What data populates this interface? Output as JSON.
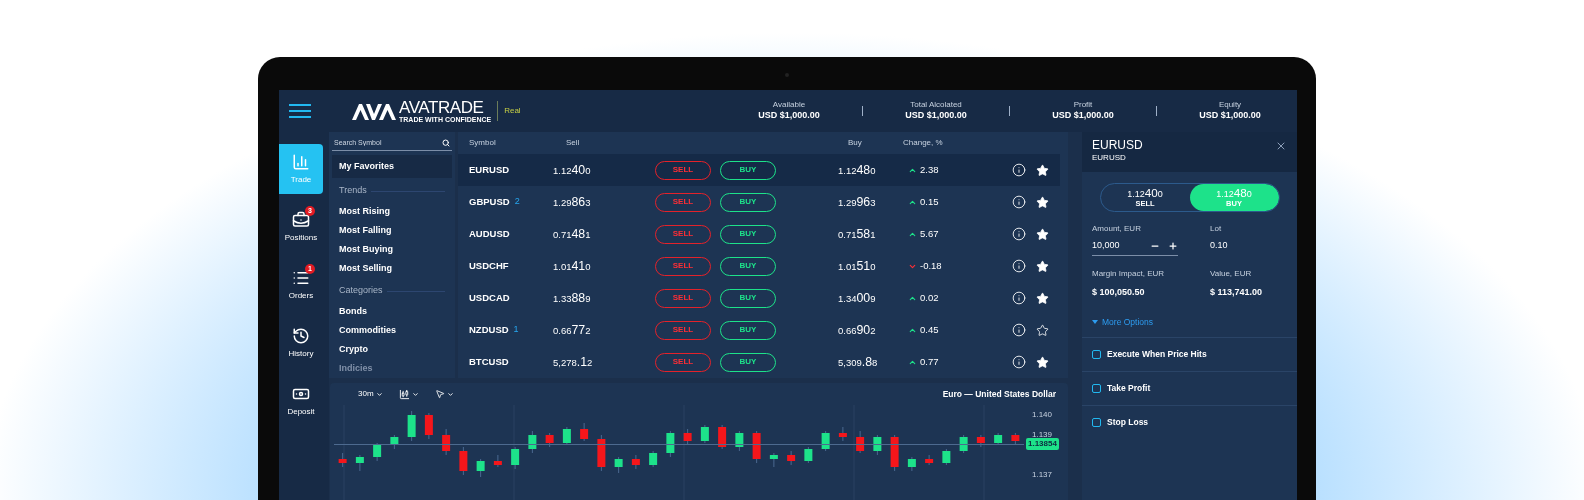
{
  "header": {
    "brand": "AVATRADE",
    "tagline": "TRADE WITH CONFIDENCE",
    "account": "Real",
    "stats": [
      {
        "label": "Available",
        "value": "USD $1,000.00"
      },
      {
        "label": "Total Alcolated",
        "value": "USD $1,000.00"
      },
      {
        "label": "Profit",
        "value": "USD $1,000.00"
      },
      {
        "label": "Equity",
        "value": "USD $1,000.00"
      }
    ]
  },
  "nav": [
    {
      "label": "Trade",
      "selected": true
    },
    {
      "label": "Positions",
      "badge": "3",
      "selected": false
    },
    {
      "label": "Orders",
      "badge": "1",
      "selected": false
    },
    {
      "label": "History",
      "selected": false
    },
    {
      "label": "Deposit",
      "selected": false
    }
  ],
  "sidebar": {
    "search": {
      "placeholder": "Search Symbol"
    },
    "items": [
      {
        "kind": "item",
        "label": "My Favorites",
        "selected": true
      },
      {
        "kind": "heading",
        "label": "Trends"
      },
      {
        "kind": "item",
        "label": "Most Rising",
        "selected": false
      },
      {
        "kind": "item",
        "label": "Most Falling",
        "selected": false
      },
      {
        "kind": "item",
        "label": "Most Buying",
        "selected": false
      },
      {
        "kind": "item",
        "label": "Most Selling",
        "selected": false
      },
      {
        "kind": "heading",
        "label": "Categories"
      },
      {
        "kind": "item",
        "label": "Bonds",
        "selected": false
      },
      {
        "kind": "item",
        "label": "Commodities",
        "selected": false
      },
      {
        "kind": "item",
        "label": "Crypto",
        "selected": false
      },
      {
        "kind": "item",
        "label": "Indicies",
        "selected": false
      }
    ]
  },
  "table": {
    "columns": [
      "Symbol",
      "Sell",
      "Buy",
      "Change, %"
    ],
    "rows": [
      {
        "symbol": "EURUSD",
        "sell": "1.12400",
        "sell_label": "SELL",
        "buy_label": "BUY",
        "buy": "1.12480",
        "change": "2.38",
        "kind": "up",
        "favorite": true,
        "selected": true
      },
      {
        "symbol": "GBPUSD",
        "count": "2",
        "sell": "1.29863",
        "sell_label": "SELL",
        "buy_label": "BUY",
        "buy": "1.29963",
        "change": "0.15",
        "kind": "up",
        "favorite": true,
        "selected": false
      },
      {
        "symbol": "AUDUSD",
        "sell": "0.71481",
        "sell_label": "SELL",
        "buy_label": "BUY",
        "buy": "0.71581",
        "change": "5.67",
        "kind": "up",
        "favorite": true,
        "selected": false
      },
      {
        "symbol": "USDCHF",
        "sell": "1.01410",
        "sell_label": "SELL",
        "buy_label": "BUY",
        "buy": "1.01510",
        "change": "-0.18",
        "kind": "down",
        "favorite": true,
        "selected": false
      },
      {
        "symbol": "USDCAD",
        "sell": "1.33889",
        "sell_label": "SELL",
        "buy_label": "BUY",
        "buy": "1.34009",
        "change": "0.02",
        "kind": "up",
        "favorite": true,
        "selected": false
      },
      {
        "symbol": "NZDUSD",
        "count": "1",
        "sell": "0.66772",
        "sell_label": "SELL",
        "buy_label": "BUY",
        "buy": "0.66902",
        "change": "0.45",
        "kind": "up",
        "favorite": false,
        "selected": false
      },
      {
        "symbol": "BTCUSD",
        "sell": "5,278.12",
        "sell_label": "SELL",
        "buy_label": "BUY",
        "buy": "5,309.88",
        "change": "0.77",
        "kind": "up",
        "favorite": true,
        "selected": false
      }
    ]
  },
  "chart": {
    "interval": "30m",
    "title": "Euro — United States Dollar",
    "chart_data": {
      "type": "candlestick",
      "ylim": [
        1.1355,
        1.1405
      ],
      "ref_lines": [
        {
          "axis": "y",
          "value": 1.13854,
          "label": "1.13854"
        }
      ],
      "yticks": [
        {
          "value": 1.14,
          "label": "1.140"
        },
        {
          "value": 1.139,
          "label": "1.139"
        },
        {
          "value": 1.137,
          "label": "1.137"
        }
      ],
      "ohlc": [
        [
          1.1378,
          1.1381,
          1.1374,
          1.1376
        ],
        [
          1.1376,
          1.138,
          1.1372,
          1.1379
        ],
        [
          1.1379,
          1.1386,
          1.1377,
          1.1385
        ],
        [
          1.1385,
          1.139,
          1.1383,
          1.1389
        ],
        [
          1.1389,
          1.1402,
          1.1387,
          1.14
        ],
        [
          1.14,
          1.1401,
          1.1388,
          1.139
        ],
        [
          1.139,
          1.1393,
          1.138,
          1.1382
        ],
        [
          1.1382,
          1.1384,
          1.137,
          1.1372
        ],
        [
          1.1372,
          1.1378,
          1.1369,
          1.1377
        ],
        [
          1.1377,
          1.138,
          1.1374,
          1.1375
        ],
        [
          1.1375,
          1.1384,
          1.1373,
          1.1383
        ],
        [
          1.1383,
          1.1392,
          1.1381,
          1.139
        ],
        [
          1.139,
          1.1391,
          1.1384,
          1.1386
        ],
        [
          1.1386,
          1.1394,
          1.1385,
          1.1393
        ],
        [
          1.1393,
          1.1396,
          1.1387,
          1.1388
        ],
        [
          1.1388,
          1.139,
          1.1372,
          1.1374
        ],
        [
          1.1374,
          1.1379,
          1.1371,
          1.1378
        ],
        [
          1.1378,
          1.138,
          1.1373,
          1.1375
        ],
        [
          1.1375,
          1.1382,
          1.1374,
          1.1381
        ],
        [
          1.1381,
          1.1392,
          1.1379,
          1.1391
        ],
        [
          1.1391,
          1.1393,
          1.1385,
          1.1387
        ],
        [
          1.1387,
          1.1395,
          1.1386,
          1.1394
        ],
        [
          1.1394,
          1.1395,
          1.1383,
          1.1384
        ],
        [
          1.1384,
          1.1392,
          1.1382,
          1.1391
        ],
        [
          1.1391,
          1.1392,
          1.1376,
          1.1378
        ],
        [
          1.1378,
          1.1381,
          1.1374,
          1.138
        ],
        [
          1.138,
          1.1382,
          1.1375,
          1.1377
        ],
        [
          1.1377,
          1.1384,
          1.1376,
          1.1383
        ],
        [
          1.1383,
          1.1392,
          1.1382,
          1.1391
        ],
        [
          1.1391,
          1.1394,
          1.1387,
          1.1389
        ],
        [
          1.1389,
          1.1392,
          1.1381,
          1.1382
        ],
        [
          1.1382,
          1.139,
          1.138,
          1.1389
        ],
        [
          1.1389,
          1.139,
          1.1372,
          1.1374
        ],
        [
          1.1374,
          1.1379,
          1.1372,
          1.1378
        ],
        [
          1.1378,
          1.138,
          1.1375,
          1.1376
        ],
        [
          1.1376,
          1.1383,
          1.1375,
          1.1382
        ],
        [
          1.1382,
          1.139,
          1.1381,
          1.1389
        ],
        [
          1.1389,
          1.139,
          1.1384,
          1.1386
        ],
        [
          1.1386,
          1.1391,
          1.1385,
          1.139
        ],
        [
          1.139,
          1.1391,
          1.1385,
          1.1387
        ]
      ]
    }
  },
  "order_panel": {
    "title": "EURUSD",
    "subtitle": "EURUSD",
    "sides": [
      {
        "price": "1.12400",
        "label": "SELL",
        "selected": false
      },
      {
        "price": "1.12480",
        "label": "BUY",
        "selected": true
      }
    ],
    "amount": {
      "label": "Amount, EUR",
      "value": "10,000"
    },
    "lot": {
      "label": "Lot",
      "value": "0.10"
    },
    "margin": {
      "label": "Margin Impact, EUR",
      "value": "$ 100,050.50"
    },
    "value": {
      "label": "Value, EUR",
      "value": "$ 113,741.00"
    },
    "more": "More Options",
    "options": [
      {
        "label": "Execute When Price Hits",
        "checked": false
      },
      {
        "label": "Take Profit",
        "checked": false
      },
      {
        "label": "Stop Loss",
        "checked": false
      }
    ]
  }
}
